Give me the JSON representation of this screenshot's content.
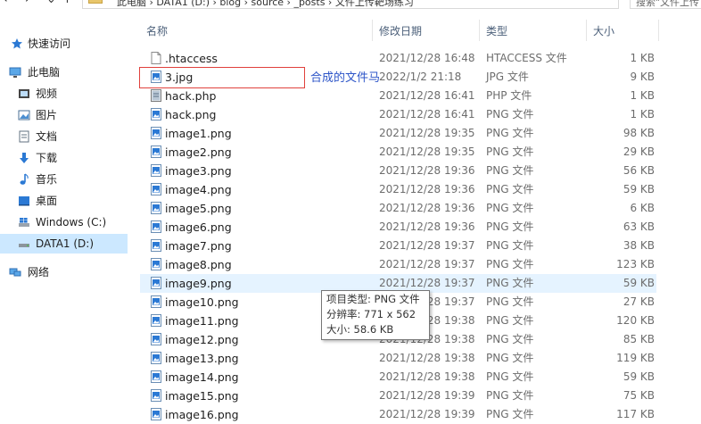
{
  "address": {
    "path": "此电脑 › DATA1 (D:) › blog › source › _posts › 文件上传靶场练习"
  },
  "search": {
    "placeholder": "搜索\"文件上传"
  },
  "sidebar": {
    "items": [
      {
        "label": "快速访问",
        "icon": "star-icon"
      },
      {
        "label": "此电脑",
        "icon": "computer-icon"
      },
      {
        "label": "视频",
        "icon": "video-icon"
      },
      {
        "label": "图片",
        "icon": "pictures-icon"
      },
      {
        "label": "文档",
        "icon": "documents-icon"
      },
      {
        "label": "下载",
        "icon": "download-icon"
      },
      {
        "label": "音乐",
        "icon": "music-icon"
      },
      {
        "label": "桌面",
        "icon": "desktop-icon"
      },
      {
        "label": "Windows (C:)",
        "icon": "windows-drive-icon"
      },
      {
        "label": "DATA1 (D:)",
        "icon": "drive-icon",
        "selected": true
      },
      {
        "label": "网络",
        "icon": "network-icon"
      }
    ]
  },
  "columns": {
    "name": "名称",
    "date": "修改日期",
    "type": "类型",
    "size": "大小"
  },
  "files": [
    {
      "name": ".htaccess",
      "date": "2021/12/28 16:48",
      "type": "HTACCESS 文件",
      "size": "1 KB",
      "icon": "blank-file-icon"
    },
    {
      "name": "3.jpg",
      "date": "2022/1/2 21:18",
      "type": "JPG 文件",
      "size": "9 KB",
      "icon": "image-file-icon"
    },
    {
      "name": "hack.php",
      "date": "2021/12/28 16:41",
      "type": "PHP 文件",
      "size": "1 KB",
      "icon": "php-file-icon"
    },
    {
      "name": "hack.png",
      "date": "2021/12/28 16:41",
      "type": "PNG 文件",
      "size": "1 KB",
      "icon": "image-file-icon"
    },
    {
      "name": "image1.png",
      "date": "2021/12/28 19:35",
      "type": "PNG 文件",
      "size": "98 KB",
      "icon": "image-file-icon"
    },
    {
      "name": "image2.png",
      "date": "2021/12/28 19:35",
      "type": "PNG 文件",
      "size": "29 KB",
      "icon": "image-file-icon"
    },
    {
      "name": "image3.png",
      "date": "2021/12/28 19:36",
      "type": "PNG 文件",
      "size": "56 KB",
      "icon": "image-file-icon"
    },
    {
      "name": "image4.png",
      "date": "2021/12/28 19:36",
      "type": "PNG 文件",
      "size": "59 KB",
      "icon": "image-file-icon"
    },
    {
      "name": "image5.png",
      "date": "2021/12/28 19:36",
      "type": "PNG 文件",
      "size": "6 KB",
      "icon": "image-file-icon"
    },
    {
      "name": "image6.png",
      "date": "2021/12/28 19:36",
      "type": "PNG 文件",
      "size": "63 KB",
      "icon": "image-file-icon"
    },
    {
      "name": "image7.png",
      "date": "2021/12/28 19:37",
      "type": "PNG 文件",
      "size": "38 KB",
      "icon": "image-file-icon"
    },
    {
      "name": "image8.png",
      "date": "2021/12/28 19:37",
      "type": "PNG 文件",
      "size": "123 KB",
      "icon": "image-file-icon"
    },
    {
      "name": "image9.png",
      "date": "2021/12/28 19:37",
      "type": "PNG 文件",
      "size": "59 KB",
      "icon": "image-file-icon",
      "hover": true
    },
    {
      "name": "image10.png",
      "date": "2021/12/28 19:37",
      "type": "PNG 文件",
      "size": "27 KB",
      "icon": "image-file-icon"
    },
    {
      "name": "image11.png",
      "date": "2021/12/28 19:38",
      "type": "PNG 文件",
      "size": "120 KB",
      "icon": "image-file-icon"
    },
    {
      "name": "image12.png",
      "date": "2021/12/28 19:38",
      "type": "PNG 文件",
      "size": "85 KB",
      "icon": "image-file-icon"
    },
    {
      "name": "image13.png",
      "date": "2021/12/28 19:38",
      "type": "PNG 文件",
      "size": "119 KB",
      "icon": "image-file-icon"
    },
    {
      "name": "image14.png",
      "date": "2021/12/28 19:38",
      "type": "PNG 文件",
      "size": "59 KB",
      "icon": "image-file-icon"
    },
    {
      "name": "image15.png",
      "date": "2021/12/28 19:39",
      "type": "PNG 文件",
      "size": "75 KB",
      "icon": "image-file-icon"
    },
    {
      "name": "image16.png",
      "date": "2021/12/28 19:39",
      "type": "PNG 文件",
      "size": "117 KB",
      "icon": "image-file-icon"
    }
  ],
  "annotation": {
    "text": "合成的文件马",
    "color": "#e0413c"
  },
  "tooltip": {
    "type_line": "项目类型: PNG 文件",
    "resolution_line": "分辨率: 771 x 562",
    "size_line": "大小: 58.6 KB"
  }
}
